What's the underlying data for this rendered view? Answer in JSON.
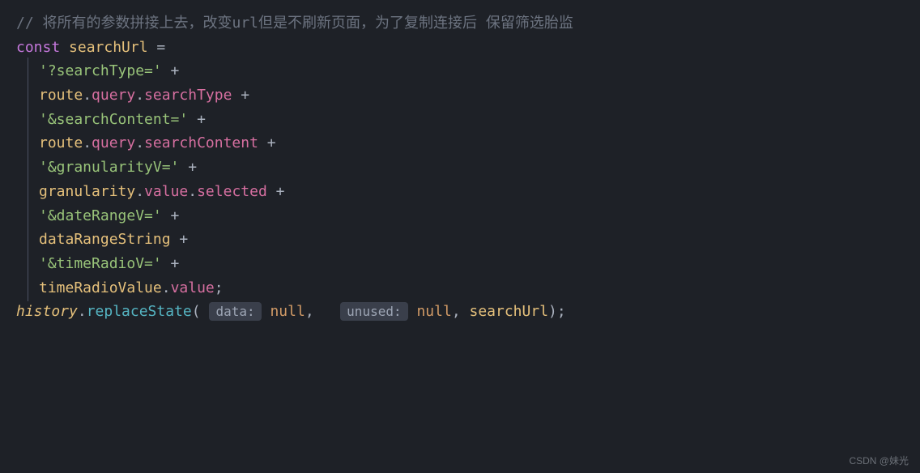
{
  "code": {
    "comment": "// 将所有的参数拼接上去，改变url但是不刷新页面，为了复制连接后 保留筛选胎监",
    "line1_const": "const",
    "line1_var": "searchUrl",
    "line1_eq": " =",
    "line2_string": "'?searchType='",
    "line2_plus": " +",
    "line3_route": "route",
    "line3_query": "query",
    "line3_searchType": "searchType",
    "line3_plus": " +",
    "line4_string": "'&searchContent='",
    "line4_plus": " +",
    "line5_route": "route",
    "line5_query": "query",
    "line5_searchContent": "searchContent",
    "line5_plus": " +",
    "line6_string": "'&granularityV='",
    "line6_plus": " +",
    "line7_granularity": "granularity",
    "line7_value": "value",
    "line7_selected": "selected",
    "line7_plus": " +",
    "line8_string": "'&dateRangeV='",
    "line8_plus": " +",
    "line9_dataRangeString": "dataRangeString",
    "line9_plus": " +",
    "line10_string": "'&timeRadioV='",
    "line10_plus": " +",
    "line11_timeRadioValue": "timeRadioValue",
    "line11_value": "value",
    "line11_semicolon": ";",
    "line12_history": "history",
    "line12_replaceState": "replaceState",
    "line12_open": "(",
    "line12_hint1": "data:",
    "line12_null1": "null",
    "line12_comma1": ",  ",
    "line12_hint2": "unused:",
    "line12_null2": "null",
    "line12_comma2": ", ",
    "line12_searchUrl": "searchUrl",
    "line12_close": ");"
  },
  "watermark": "CSDN @妹光"
}
